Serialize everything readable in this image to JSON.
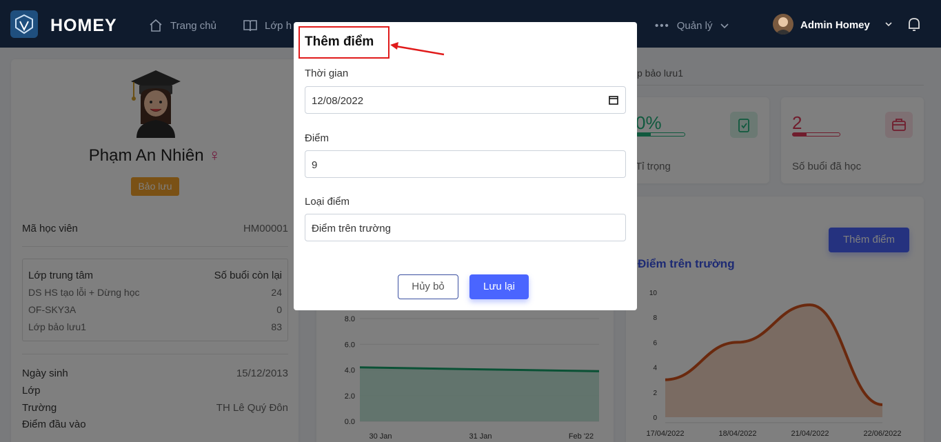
{
  "navbar": {
    "brand": "HOMEY",
    "home": "Trang chủ",
    "classes": "Lớp h",
    "manage": "Quản lý",
    "user": "Admin Homey"
  },
  "profile": {
    "name": "Phạm An Nhiên",
    "gender_symbol": "♀",
    "status": "Bảo lưu",
    "student_id_label": "Mã học viên",
    "student_id": "HM00001",
    "table": {
      "col1": "Lớp trung tâm",
      "col2": "Số buổi còn lại",
      "rows": [
        {
          "name": "DS HS tạo lỗi + Dừng học",
          "value": "24"
        },
        {
          "name": "OF-SKY3A",
          "value": "0"
        },
        {
          "name": "Lớp bảo lưu1",
          "value": "83"
        }
      ]
    },
    "dob_label": "Ngày sinh",
    "dob": "15/12/2013",
    "class_label": "Lớp",
    "school_label": "Trường",
    "school": "TH Lê Quý Đôn",
    "entry_label": "Điểm đầu vào"
  },
  "right": {
    "tab": "p bảo lưu1",
    "stat1_value": "0%",
    "stat1_label": "Tỉ trọng",
    "stat2_value": "2",
    "stat2_label": "Số buổi đã học",
    "add_score_button": "Thêm điểm",
    "chart_title": "Điểm trên trường"
  },
  "left_chart_data": {
    "type": "area",
    "x": [
      "30 Jan",
      "31 Jan",
      "Feb '22"
    ],
    "values": [
      4.2,
      4.05,
      3.9
    ],
    "yticks": [
      "0.0",
      "2.0",
      "4.0",
      "6.0",
      "8.0"
    ],
    "ylim": [
      0,
      8
    ]
  },
  "chart_data": {
    "type": "area",
    "title": "Điểm trên trường",
    "categories": [
      "17/04/2022",
      "18/04/2022",
      "21/04/2022",
      "22/06/2022"
    ],
    "values": [
      3,
      6,
      9,
      1
    ],
    "yticks": [
      "0",
      "2",
      "4",
      "6",
      "8",
      "10"
    ],
    "ylim": [
      0,
      10
    ],
    "color": "#d4531c"
  },
  "modal": {
    "title": "Thêm điểm",
    "time_label": "Thời gian",
    "time_value": "12/08/2022",
    "score_label": "Điểm",
    "score_value": "9",
    "type_label": "Loại điểm",
    "type_value": "Điểm trên trường",
    "cancel": "Hủy bỏ",
    "save": "Lưu lại"
  }
}
